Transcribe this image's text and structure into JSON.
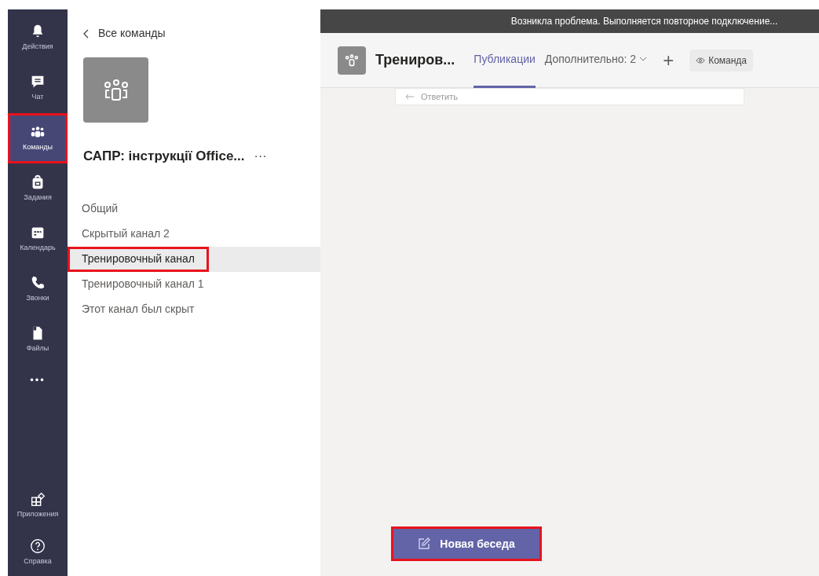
{
  "rail": [
    {
      "kind": "bell",
      "label": "Действия",
      "selected": false,
      "highlighted": false
    },
    {
      "kind": "chat",
      "label": "Чат",
      "selected": false,
      "highlighted": false
    },
    {
      "kind": "teams",
      "label": "Команды",
      "selected": true,
      "highlighted": true
    },
    {
      "kind": "bag",
      "label": "Задания",
      "selected": false,
      "highlighted": false
    },
    {
      "kind": "calendar",
      "label": "Календарь",
      "selected": false,
      "highlighted": false
    },
    {
      "kind": "phone",
      "label": "Звонки",
      "selected": false,
      "highlighted": false
    },
    {
      "kind": "file",
      "label": "Файлы",
      "selected": false,
      "highlighted": false
    }
  ],
  "rail_more": "•••",
  "rail_bottom": [
    {
      "kind": "apps",
      "label": "Приложения"
    },
    {
      "kind": "help",
      "label": "Справка"
    }
  ],
  "sidebar": {
    "back": "Все команды",
    "team_name": "САПР: інструкції Office...",
    "team_menu": "···",
    "channels": [
      {
        "label": "Общий",
        "selected": false,
        "highlighted": false
      },
      {
        "label": "Скрытый канал 2",
        "selected": false,
        "highlighted": false
      },
      {
        "label": "Тренировочный канал",
        "selected": true,
        "highlighted": true
      },
      {
        "label": "Тренировочный канал 1",
        "selected": false,
        "highlighted": false
      },
      {
        "label": "Этот канал был скрыт",
        "selected": false,
        "highlighted": false
      }
    ]
  },
  "banner": "Возникла проблема. Выполняется повторное подключение...",
  "header": {
    "title": "Трениров...",
    "tabs": [
      {
        "label": "Публикации",
        "selected": true
      },
      {
        "label": "Дополнительно: 2",
        "selected": false
      }
    ],
    "add": "+",
    "team_button": "Команда"
  },
  "reply": "Ответить",
  "new_conversation": {
    "label": "Новая беседа",
    "highlighted": true
  }
}
